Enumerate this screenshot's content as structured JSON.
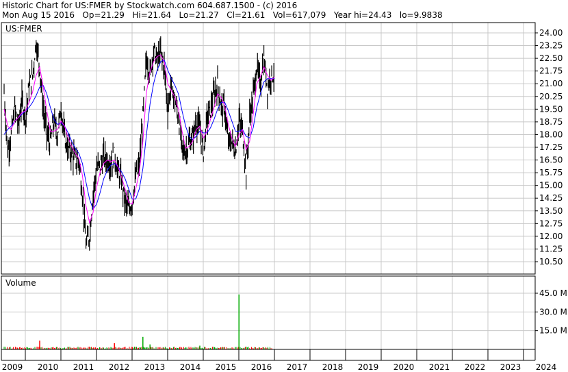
{
  "header": {
    "line1": "Historic Chart for US:FMER by Stockwatch.com 604.687.1500 - (c) 2016",
    "line2": "Mon Aug 15 2016   Op=21.29   Hi=21.64   Lo=21.27   Cl=21.61   Vol=617,079   Year hi=24.43   lo=9.9838"
  },
  "chart_data": {
    "type": "line",
    "price_panel": {
      "label": "US:FMER",
      "ylim": [
        10.0,
        24.5
      ],
      "y_ticks": [
        "24.00",
        "23.25",
        "22.50",
        "21.75",
        "21.00",
        "20.25",
        "19.50",
        "18.75",
        "18.00",
        "17.25",
        "16.50",
        "15.75",
        "15.00",
        "14.25",
        "13.50",
        "12.75",
        "12.00",
        "11.25",
        "10.50"
      ],
      "grid": true
    },
    "volume_panel": {
      "label": "Volume",
      "y_ticks": [
        "45.0 M",
        "30.0 M",
        "15.0 M"
      ],
      "ylim": [
        0,
        52
      ],
      "grid": true
    },
    "x_ticks": [
      "2009",
      "2010",
      "2011",
      "2012",
      "2013",
      "2014",
      "2015",
      "2016",
      "2017",
      "2018",
      "2019",
      "2020",
      "2021",
      "2022",
      "2023",
      "2024"
    ],
    "price_series": {
      "x": [
        2009.0,
        2009.1,
        2009.2,
        2009.3,
        2009.4,
        2009.5,
        2009.6,
        2009.7,
        2009.8,
        2009.9,
        2010.0,
        2010.1,
        2010.2,
        2010.3,
        2010.4,
        2010.5,
        2010.6,
        2010.7,
        2010.8,
        2010.9,
        2011.0,
        2011.1,
        2011.2,
        2011.3,
        2011.4,
        2011.5,
        2011.6,
        2011.7,
        2011.8,
        2011.9,
        2012.0,
        2012.1,
        2012.2,
        2012.3,
        2012.4,
        2012.5,
        2012.6,
        2012.7,
        2012.8,
        2012.9,
        2013.0,
        2013.1,
        2013.2,
        2013.3,
        2013.4,
        2013.5,
        2013.6,
        2013.7,
        2013.8,
        2013.9,
        2014.0,
        2014.1,
        2014.2,
        2014.3,
        2014.4,
        2014.5,
        2014.6,
        2014.7,
        2014.8,
        2014.9,
        2015.0,
        2015.1,
        2015.2,
        2015.3,
        2015.4,
        2015.5,
        2015.6,
        2015.7,
        2015.8,
        2015.9,
        2016.0,
        2016.1,
        2016.2,
        2016.3,
        2016.4,
        2016.5,
        2016.6
      ],
      "close": [
        20.5,
        17.0,
        18.0,
        19.5,
        18.5,
        20.0,
        19.0,
        20.8,
        21.5,
        23.5,
        22.0,
        19.5,
        18.0,
        17.5,
        18.8,
        18.0,
        19.6,
        17.8,
        17.2,
        16.9,
        16.5,
        16.5,
        14.5,
        11.5,
        12.0,
        14.5,
        16.0,
        16.2,
        16.7,
        16.5,
        16.3,
        16.8,
        15.8,
        15.3,
        14.0,
        13.6,
        14.0,
        15.5,
        16.2,
        19.0,
        22.5,
        21.6,
        23.0,
        22.4,
        22.8,
        22.0,
        19.5,
        21.0,
        20.0,
        19.0,
        17.2,
        17.0,
        17.5,
        17.8,
        18.8,
        18.3,
        16.9,
        19.0,
        19.5,
        20.3,
        21.0,
        19.7,
        19.5,
        17.5,
        17.6,
        17.0,
        18.8,
        18.2,
        15.8,
        19.0,
        20.3,
        22.0,
        21.0,
        22.5,
        20.8,
        21.5,
        21.6
      ],
      "ma_short": [
        19.5,
        18.5,
        18.3,
        18.8,
        19.0,
        19.3,
        19.4,
        19.9,
        20.5,
        21.5,
        22.0,
        20.8,
        19.4,
        18.2,
        18.2,
        18.3,
        18.8,
        18.5,
        17.8,
        17.3,
        16.9,
        16.6,
        15.6,
        13.8,
        12.8,
        13.4,
        14.9,
        15.8,
        16.3,
        16.5,
        16.4,
        16.5,
        16.1,
        15.5,
        14.8,
        14.0,
        13.9,
        14.8,
        15.8,
        17.6,
        20.5,
        21.7,
        22.3,
        22.6,
        22.7,
        22.3,
        21.0,
        20.6,
        20.2,
        19.5,
        18.2,
        17.2,
        17.3,
        17.6,
        18.3,
        18.5,
        17.8,
        18.2,
        18.9,
        19.6,
        20.4,
        20.2,
        19.7,
        18.6,
        17.8,
        17.3,
        18.0,
        18.3,
        17.1,
        17.6,
        19.2,
        21.0,
        21.4,
        22.0,
        21.5,
        21.2,
        21.4
      ],
      "ma_long": [
        18.0,
        18.3,
        18.5,
        18.8,
        19.0,
        19.2,
        19.4,
        19.6,
        19.9,
        20.3,
        20.8,
        20.9,
        20.4,
        19.6,
        18.9,
        18.6,
        18.7,
        18.5,
        18.1,
        17.6,
        17.2,
        16.9,
        16.3,
        15.2,
        14.2,
        13.6,
        13.9,
        14.6,
        15.4,
        15.9,
        16.2,
        16.3,
        16.1,
        15.8,
        15.4,
        14.8,
        14.2,
        14.2,
        14.8,
        16.0,
        18.0,
        19.8,
        21.0,
        21.8,
        22.3,
        22.4,
        21.8,
        21.3,
        20.9,
        20.4,
        19.4,
        18.5,
        17.9,
        17.7,
        17.9,
        18.2,
        18.1,
        18.1,
        18.4,
        18.9,
        19.5,
        19.9,
        19.9,
        19.4,
        18.8,
        18.2,
        18.2,
        18.3,
        17.9,
        17.8,
        18.4,
        19.6,
        20.4,
        21.1,
        21.3,
        21.3,
        21.3
      ]
    },
    "volume_markers": [
      {
        "x": 2010.0,
        "value": 7,
        "color": "red"
      },
      {
        "x": 2012.1,
        "value": 5,
        "color": "red"
      },
      {
        "x": 2012.9,
        "value": 10,
        "color": "green"
      },
      {
        "x": 2013.1,
        "value": 4,
        "color": "green"
      },
      {
        "x": 2014.5,
        "value": 3,
        "color": "green"
      },
      {
        "x": 2015.6,
        "value": 44,
        "color": "green"
      }
    ],
    "colors": {
      "price_bars": "#000000",
      "ma_short": "#ff00ff",
      "ma_long": "#0000ff",
      "vol_up": "#00aa00",
      "vol_down": "#ff0000",
      "grid": "#c8c8c8"
    }
  }
}
